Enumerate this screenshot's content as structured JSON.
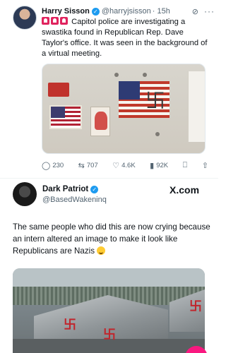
{
  "quoted": {
    "name": "Harry Sisson",
    "handle": "@harryjsisson",
    "time": "· 15h",
    "more": "···",
    "text": "Capitol police are investigating a swastika found in Republican Rep. Dave Taylor's office. It was seen in the background of a virtual meeting.",
    "icons": [
      "verified-badge-icon",
      "siren-icon",
      "grok-icon",
      "more-icon"
    ],
    "stats": {
      "replies": "230",
      "reposts": "707",
      "likes": "4.6K",
      "views": "92K"
    }
  },
  "post": {
    "name": "Dark Patriot",
    "handle": "@BasedWakeninq",
    "brand": "X.com",
    "text": "The same people who did this are now crying because an intern altered an image to make it look like Republicans are Nazis",
    "emoji": "grinning-sweat-icon"
  },
  "colors": {
    "verified": "#1d9bf0",
    "secondary_text": "#536471",
    "fab": "#f91880"
  }
}
